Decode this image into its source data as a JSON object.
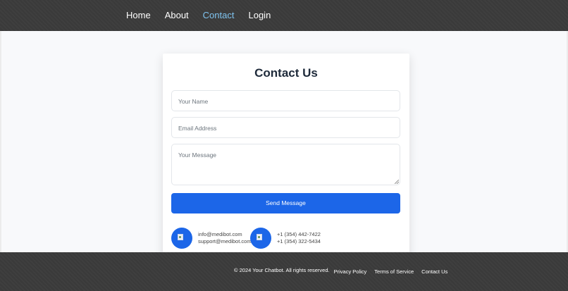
{
  "nav": {
    "items": [
      {
        "label": "Home",
        "active": false
      },
      {
        "label": "About",
        "active": false
      },
      {
        "label": "Contact",
        "active": true
      },
      {
        "label": "Login",
        "active": false
      }
    ]
  },
  "contact_form": {
    "title": "Contact Us",
    "name_placeholder": "Your Name",
    "email_placeholder": "Email Address",
    "message_placeholder": "Your Message",
    "submit_label": "Send Message"
  },
  "contact_info": {
    "email": {
      "icon": "email-image-icon",
      "lines": [
        "info@medibot.com",
        "support@medibot.com"
      ]
    },
    "phone": {
      "icon": "phone-image-icon",
      "lines": [
        "+1 (354) 442-7422",
        "+1 (354) 322-5434"
      ]
    }
  },
  "footer": {
    "copyright": "© 2024 Your Chatbot. All rights reserved.",
    "links": [
      "Privacy Policy",
      "Terms of Service",
      "Contact Us"
    ]
  },
  "colors": {
    "header_bg": "#3a3a3a",
    "accent": "#1c66e8",
    "active_nav": "#7fc3ef",
    "page_bg": "#f8f9fb"
  }
}
